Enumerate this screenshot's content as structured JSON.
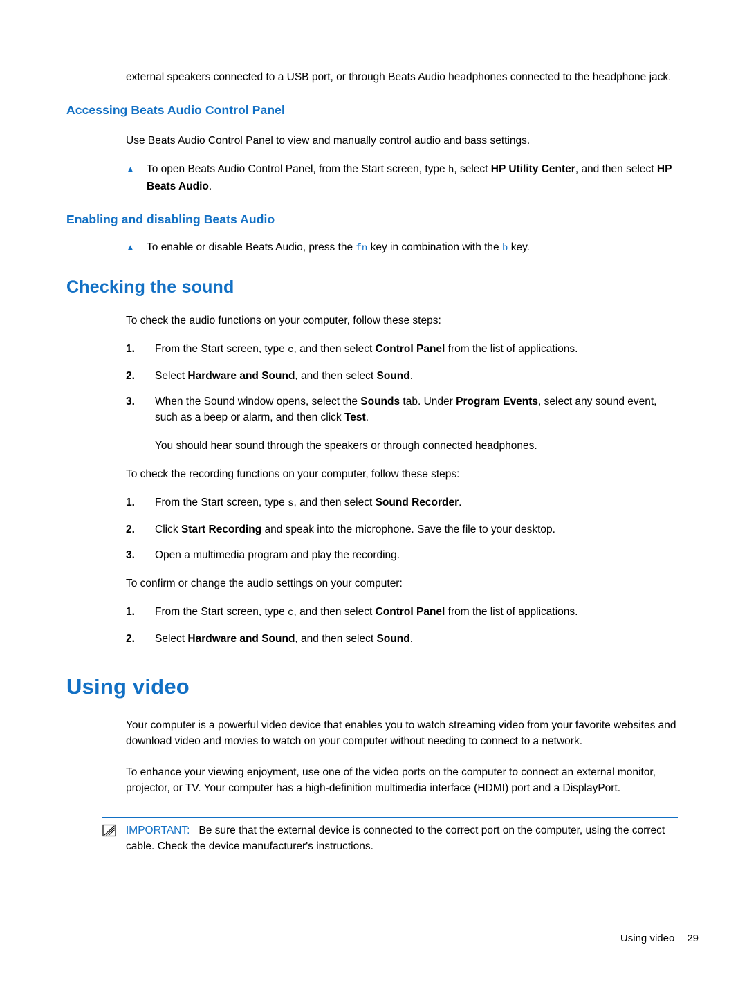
{
  "document": {
    "intro_paragraph": "external speakers connected to a USB port, or through Beats Audio headphones connected to the headphone jack.",
    "heading_accessing": "Accessing Beats Audio Control Panel",
    "accessing_para": "Use Beats Audio Control Panel to view and manually control audio and bass settings.",
    "accessing_bullet": {
      "pre": "To open Beats Audio Control Panel, from the Start screen, type ",
      "key": "h",
      "mid": ", select ",
      "bold1": "HP Utility Center",
      "mid2": ", and then select ",
      "bold2": "HP Beats Audio",
      "end": "."
    },
    "heading_enabling": "Enabling and disabling Beats Audio",
    "enabling_bullet": {
      "pre": "To enable or disable Beats Audio, press the ",
      "key1": "fn",
      "mid": " key in combination with the ",
      "key2": "b",
      "end": " key."
    },
    "heading_checking_sound": "Checking the sound",
    "checking_intro": "To check the audio functions on your computer, follow these steps:",
    "audio_steps": [
      {
        "num": "1.",
        "pre": "From the Start screen, type ",
        "key": "c",
        "mid": ", and then select ",
        "bold": "Control Panel",
        "end": " from the list of applications."
      },
      {
        "num": "2.",
        "pre": "Select ",
        "bold": "Hardware and Sound",
        "mid": ", and then select ",
        "bold2": "Sound",
        "end": "."
      },
      {
        "num": "3.",
        "pre": "When the Sound window opens, select the ",
        "bold": "Sounds",
        "mid": " tab. Under ",
        "bold2": "Program Events",
        "mid2": ", select any sound event, such as a beep or alarm, and then click ",
        "bold3": "Test",
        "end": "."
      }
    ],
    "audio_note": "You should hear sound through the speakers or through connected headphones.",
    "recording_intro": "To check the recording functions on your computer, follow these steps:",
    "recording_steps": [
      {
        "num": "1.",
        "pre": "From the Start screen, type ",
        "key": "s",
        "mid": ", and then select ",
        "bold": "Sound Recorder",
        "end": "."
      },
      {
        "num": "2.",
        "pre": "Click ",
        "bold": "Start Recording",
        "end": " and speak into the microphone. Save the file to your desktop."
      },
      {
        "num": "3.",
        "pre": "Open a multimedia program and play the recording.",
        "end": ""
      }
    ],
    "confirm_intro": "To confirm or change the audio settings on your computer:",
    "confirm_steps": [
      {
        "num": "1.",
        "pre": "From the Start screen, type ",
        "key": "c",
        "mid": ", and then select ",
        "bold": "Control Panel",
        "end": " from the list of applications."
      },
      {
        "num": "2.",
        "pre": "Select ",
        "bold": "Hardware and Sound",
        "mid": ", and then select ",
        "bold2": "Sound",
        "end": "."
      }
    ],
    "heading_using_video": "Using video",
    "video_para1": "Your computer is a powerful video device that enables you to watch streaming video from your favorite websites and download video and movies to watch on your computer without needing to connect to a network.",
    "video_para2": "To enhance your viewing enjoyment, use one of the video ports on the computer to connect an external monitor, projector, or TV. Your computer has a high-definition multimedia interface (HDMI) port and a DisplayPort.",
    "important_label": "IMPORTANT:",
    "important_text": "Be sure that the external device is connected to the correct port on the computer, using the correct cable. Check the device manufacturer's instructions."
  },
  "footer": {
    "chapter": "Using video",
    "page_number": "29"
  },
  "colors": {
    "heading_blue": "#1270c4",
    "text_black": "#000000",
    "rule_blue": "#1270c4"
  },
  "icons": {
    "bullet": "triangle-bullet-icon",
    "note": "note-pencil-icon"
  }
}
